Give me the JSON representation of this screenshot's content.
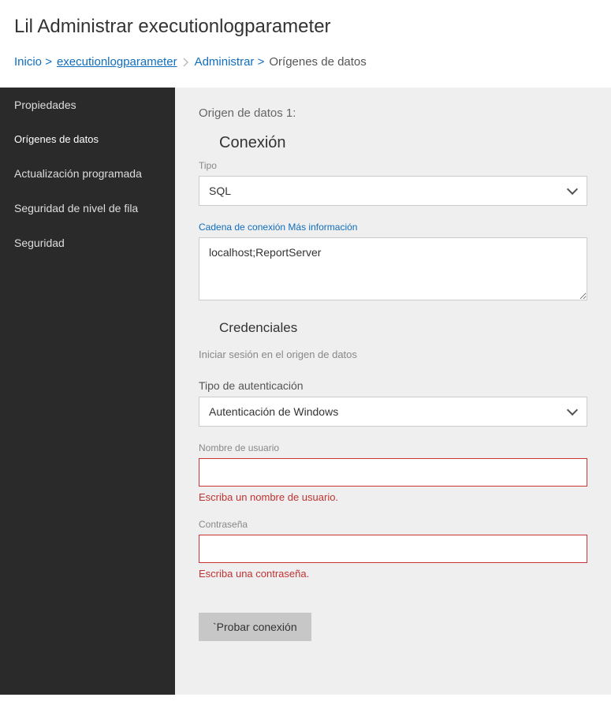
{
  "header": {
    "title": "Lil Administrar executionlogparameter"
  },
  "breadcrumb": {
    "home": "Inicio",
    "item1": "executionlogparameter",
    "item2": "Administrar",
    "current": "Orígenes de datos"
  },
  "sidebar": {
    "items": [
      {
        "label": "Propiedades"
      },
      {
        "label": "Orígenes de datos"
      },
      {
        "label": "Actualización programada"
      },
      {
        "label": "Seguridad de nivel de fila"
      },
      {
        "label": "Seguridad"
      }
    ]
  },
  "content": {
    "ds_heading": "Origen de datos 1:",
    "connection_title": "Conexión",
    "type_label": "Tipo",
    "type_value": "SQL",
    "connstr_label": "Cadena de conexión Más información",
    "connstr_value": "localhost;ReportServer",
    "creds_title": "Credenciales",
    "creds_subtitle": "Iniciar sesión en el origen de datos",
    "auth_type_label": "Tipo de autenticación",
    "auth_type_value": "Autenticación de Windows",
    "username_label": "Nombre de usuario",
    "username_value": "",
    "username_error": "Escriba un nombre de usuario.",
    "password_label": "Contraseña",
    "password_value": "",
    "password_error": "Escriba una contraseña.",
    "test_button": "`Probar conexión"
  }
}
